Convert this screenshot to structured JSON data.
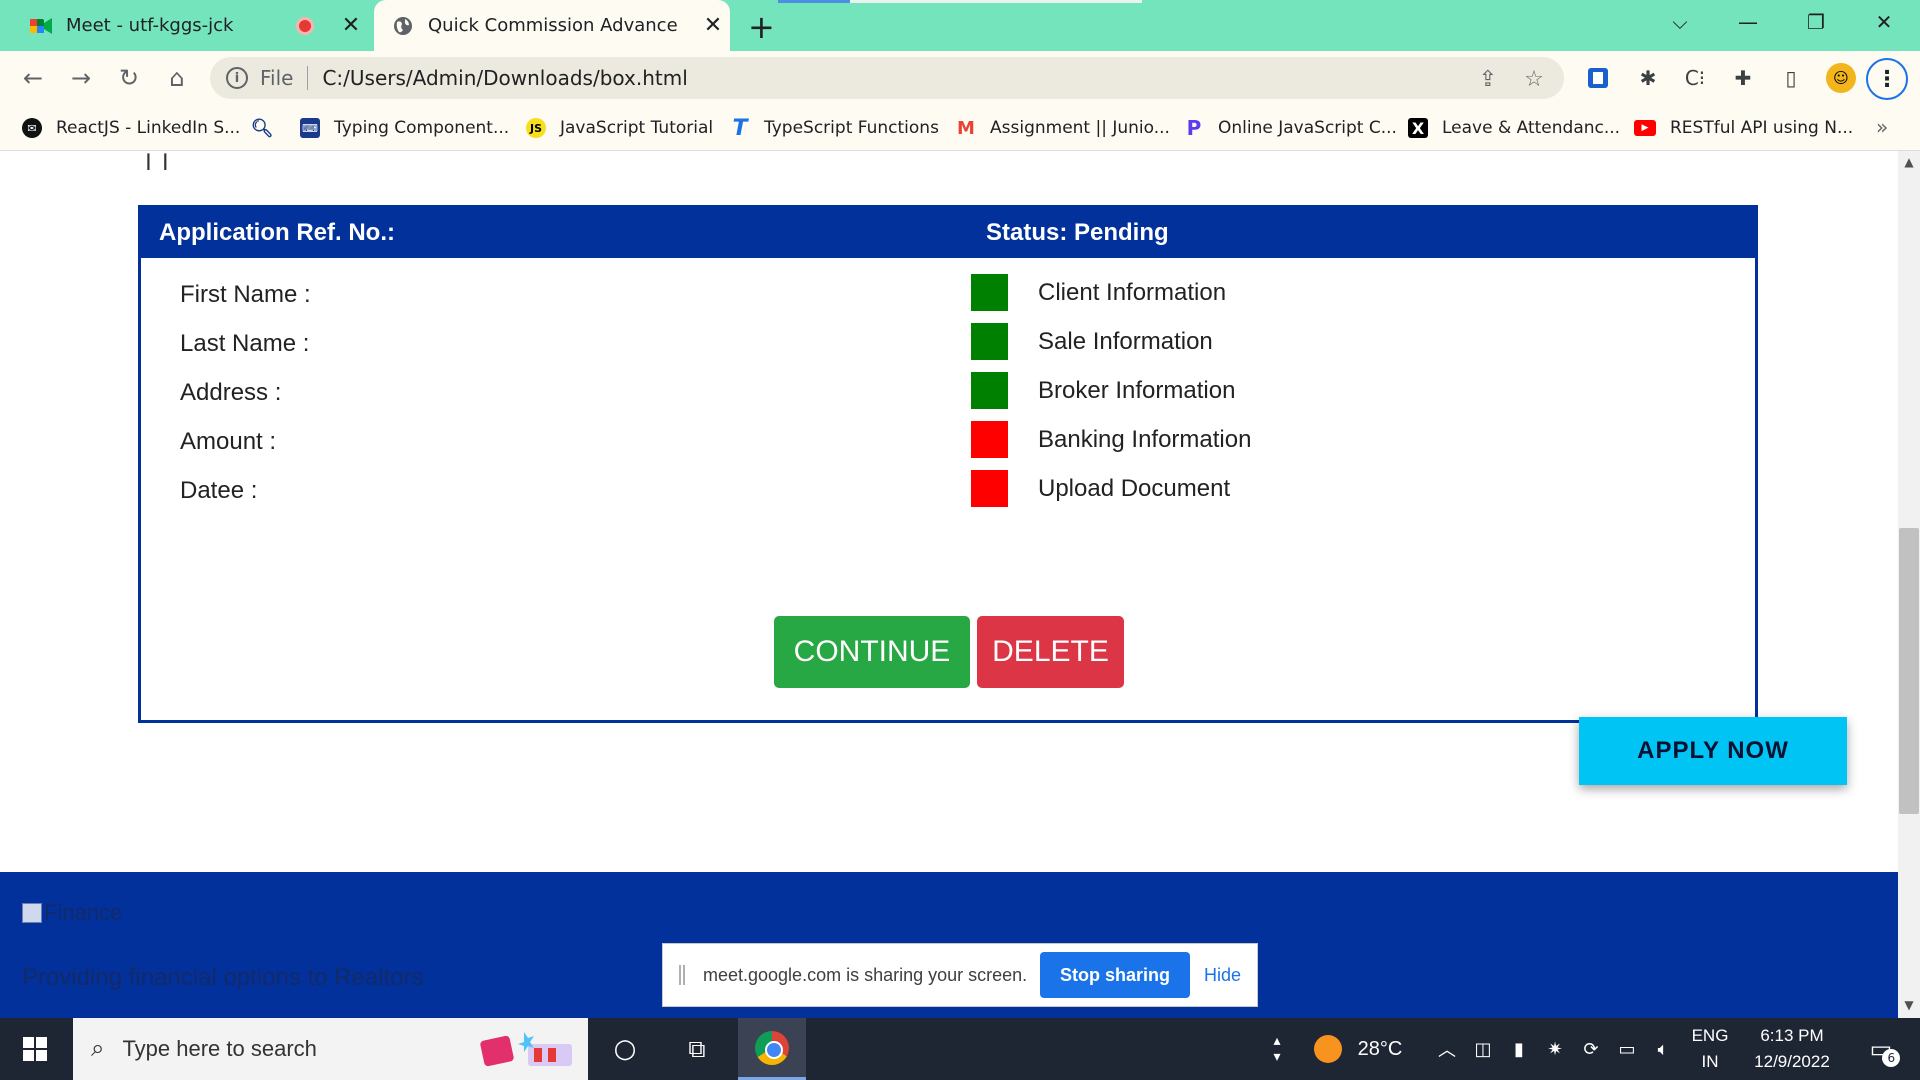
{
  "browser": {
    "tabs": [
      {
        "title": "Meet - utf-kggs-jck",
        "close": "✕"
      },
      {
        "title": "Quick Commission Advance",
        "close": "✕"
      }
    ],
    "new_tab": "+",
    "window_controls": {
      "dropdown": "⌵",
      "minimize": "—",
      "restore": "❐",
      "close": "✕"
    },
    "address": {
      "scheme": "File",
      "url": "C:/Users/Admin/Downloads/box.html"
    },
    "bookmarks": [
      {
        "label": "ReactJS - LinkedIn S...",
        "icon": "linkedin-icon"
      },
      {
        "label": "",
        "icon": "search-icon"
      },
      {
        "label": "Typing Component...",
        "icon": "typing-icon"
      },
      {
        "label": "JavaScript Tutorial",
        "icon": "js-icon"
      },
      {
        "label": "TypeScript Functions",
        "icon": "typescript-icon"
      },
      {
        "label": "Assignment || Junio...",
        "icon": "gmail-icon"
      },
      {
        "label": "Online JavaScript C...",
        "icon": "programiz-icon"
      },
      {
        "label": "Leave & Attendanc...",
        "icon": "x-icon"
      },
      {
        "label": "RESTful API using N...",
        "icon": "youtube-icon"
      }
    ],
    "bookmarks_more": "»"
  },
  "page": {
    "header": {
      "ref_label": "Application Ref. No.:",
      "status_label": "Status: Pending"
    },
    "fields": [
      {
        "label": "First Name :"
      },
      {
        "label": "Last Name :"
      },
      {
        "label": "Address :"
      },
      {
        "label": "Amount :"
      },
      {
        "label": "Datee :"
      }
    ],
    "checklist": [
      {
        "label": "Client Information",
        "status": "complete",
        "color": "#008000"
      },
      {
        "label": "Sale Information",
        "status": "complete",
        "color": "#008000"
      },
      {
        "label": "Broker Information",
        "status": "complete",
        "color": "#008000"
      },
      {
        "label": "Banking Information",
        "status": "incomplete",
        "color": "#ff0000"
      },
      {
        "label": "Upload Document",
        "status": "incomplete",
        "color": "#ff0000"
      }
    ],
    "buttons": {
      "continue": "CONTINUE",
      "delete": "DELETE"
    },
    "footer": {
      "image_alt": "Finance",
      "tagline": "Providing financial options to Realtors",
      "apply": "APPLY NOW"
    }
  },
  "share_bar": {
    "message": "meet.google.com is sharing your screen.",
    "stop": "Stop sharing",
    "hide": "Hide"
  },
  "taskbar": {
    "search_placeholder": "Type here to search",
    "weather": "28°C",
    "language": "ENG",
    "region": "IN",
    "time": "6:13 PM",
    "date": "12/9/2022",
    "notifications": "6"
  },
  "colors": {
    "brand_blue": "#02319b",
    "continue_green": "#28a745",
    "delete_red": "#dc3545",
    "apply_cyan": "#00c4f4",
    "tab_strip": "#74e4bd"
  }
}
